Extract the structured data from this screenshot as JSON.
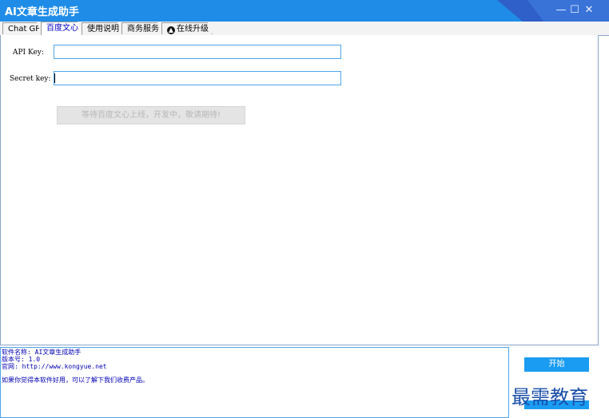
{
  "window": {
    "title": "AI文章生成助手",
    "controls": {
      "minimize": "—",
      "maximize": "☐",
      "close": "✕"
    }
  },
  "tabs": [
    {
      "label": "Chat GPT",
      "active": false
    },
    {
      "label": "百度文心",
      "active": true
    },
    {
      "label": "使用说明",
      "active": false
    },
    {
      "label": "商务服务",
      "active": false
    },
    {
      "label": "在线升级",
      "active": false,
      "icon": "upload-circle-icon"
    }
  ],
  "form": {
    "api_key_label": "API Key:",
    "api_key_value": "",
    "secret_key_label": "Secret key:",
    "secret_key_value": "",
    "wait_button": "等待百度文心上线，开发中，敬请期待!"
  },
  "info": {
    "software_name": "软件名称: AI文章生成助手",
    "version": "版本号: 1.0",
    "website": "官网: http://www.kongyue.net",
    "promo": "如果你觉得本软件好用，可以了解下我们收费产品。"
  },
  "actions": {
    "start_label": "开始"
  },
  "watermark": "最需教育",
  "colors": {
    "titlebar": "#1f8ce8",
    "accent": "#1a9cf2",
    "info_text": "#0000b4",
    "active_tab_text": "#0000c8"
  }
}
